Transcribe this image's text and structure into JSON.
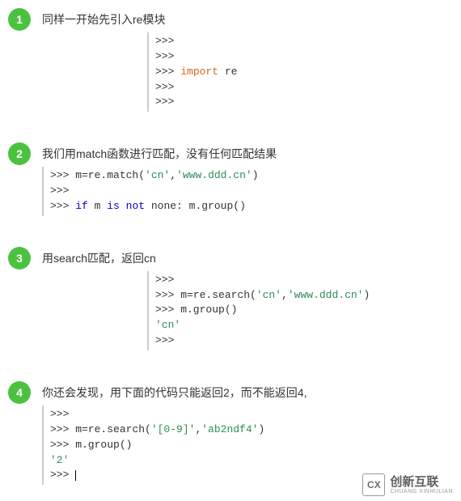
{
  "steps": [
    {
      "num": "1",
      "heading": "同样一开始先引入re模块",
      "code_html": ">>><br>>>><br>>>> <span class='kw-orange'>import</span> re<br>>>><br>>>>",
      "indent": "indent-1"
    },
    {
      "num": "2",
      "heading": "我们用match函数进行匹配，没有任何匹配结果",
      "code_html": ">>> m=re.match(<span class='str-green'>'cn'</span>,<span class='str-green'>'www.ddd.cn'</span>)<br>>>><br>>>> <span class='kw-blue'>if</span> m <span class='kw-blue'>is not</span> none: m.group()",
      "indent": ""
    },
    {
      "num": "3",
      "heading": "用search匹配，返回cn",
      "code_html": ">>><br>>>> m=re.search(<span class='str-green'>'cn'</span>,<span class='str-green'>'www.ddd.cn'</span>)<br>>>> m.group()<br><span class='str-green'>'cn'</span><br>>>>",
      "indent": "indent-2"
    },
    {
      "num": "4",
      "heading": "你还会发现，用下面的代码只能返回2，而不能返回4,",
      "code_html": ">>><br>>>> m=re.search(<span class='str-green'>'[0-9]'</span>,<span class='str-green'>'ab2ndf4'</span>)<br>>>> m.group()<br><span class='str-green'>'2'</span><br>>>> <span class='cursor'></span>",
      "indent": ""
    }
  ],
  "watermark": {
    "logo_text": "CX",
    "brand_cn": "创新互联",
    "brand_en": "CHUANG XINHULIAN"
  }
}
